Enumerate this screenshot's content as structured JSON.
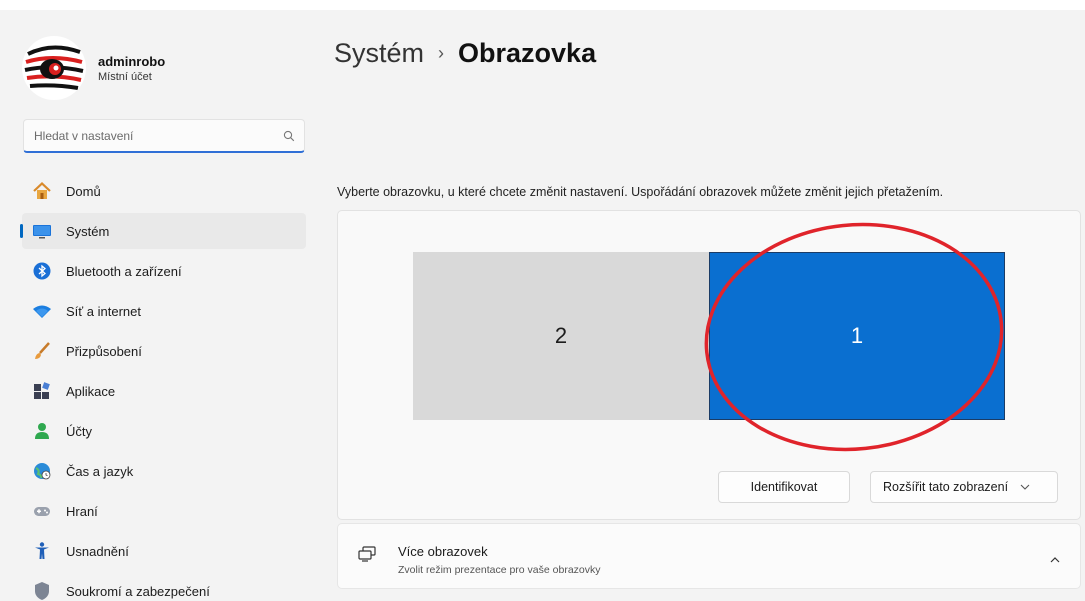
{
  "user": {
    "name": "adminrobo",
    "account_type": "Místní účet"
  },
  "search": {
    "placeholder": "Hledat v nastavení"
  },
  "nav": {
    "items": [
      {
        "label": "Domů",
        "icon": "home-icon",
        "active": false
      },
      {
        "label": "Systém",
        "icon": "system-icon",
        "active": true
      },
      {
        "label": "Bluetooth a zařízení",
        "icon": "bluetooth-icon",
        "active": false
      },
      {
        "label": "Síť a internet",
        "icon": "wifi-icon",
        "active": false
      },
      {
        "label": "Přizpůsobení",
        "icon": "brush-icon",
        "active": false
      },
      {
        "label": "Aplikace",
        "icon": "apps-icon",
        "active": false
      },
      {
        "label": "Účty",
        "icon": "account-icon",
        "active": false
      },
      {
        "label": "Čas a jazyk",
        "icon": "globe-clock-icon",
        "active": false
      },
      {
        "label": "Hraní",
        "icon": "gamepad-icon",
        "active": false
      },
      {
        "label": "Usnadnění",
        "icon": "accessibility-icon",
        "active": false
      },
      {
        "label": "Soukromí a zabezpečení",
        "icon": "shield-icon",
        "active": false
      }
    ]
  },
  "header": {
    "parent": "Systém",
    "separator": "›",
    "current": "Obrazovka"
  },
  "display": {
    "instruction": "Vyberte obrazovku, u které chcete změnit nastavení. Uspořádání obrazovek můžete změnit jejich přetažením.",
    "monitors": [
      {
        "label": "2",
        "selected": false
      },
      {
        "label": "1",
        "selected": true
      }
    ],
    "identify_label": "Identifikovat",
    "mode_label": "Rozšířit tato zobrazení"
  },
  "multiple_displays": {
    "title": "Více obrazovek",
    "subtitle": "Zvolit režim prezentace pro vaše obrazovky"
  },
  "colors": {
    "accent": "#0067c0",
    "selected_monitor": "#0a6fd0",
    "unselected_monitor": "#d9d9d9",
    "annotation": "#e0242b"
  }
}
